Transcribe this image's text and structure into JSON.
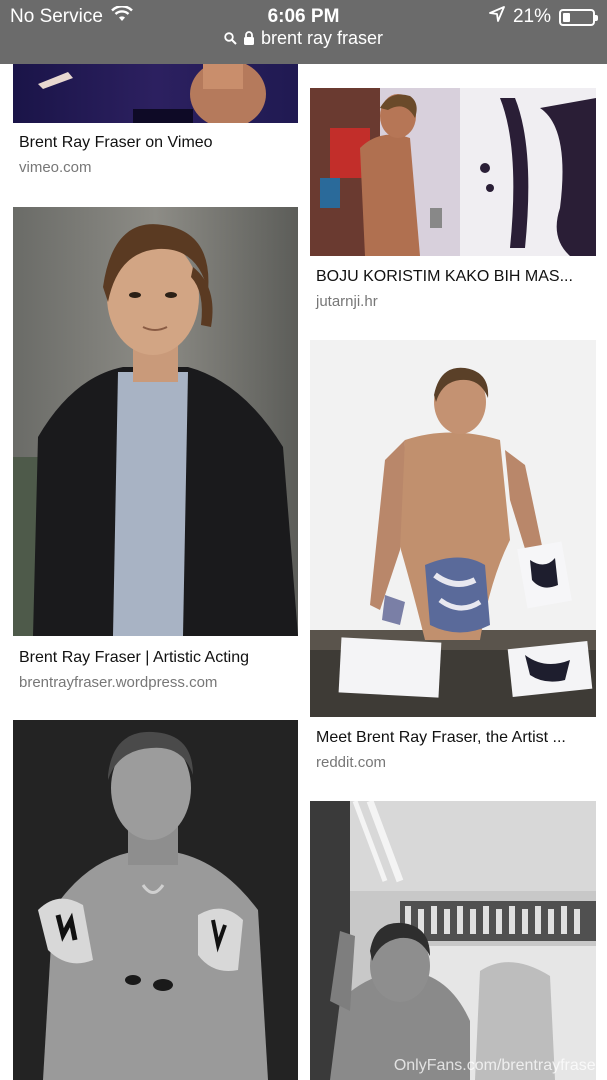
{
  "status_bar": {
    "carrier": "No Service",
    "time": "6:06 PM",
    "battery_percent": "21%",
    "battery_level": 0.21,
    "icons": [
      "wifi-icon",
      "location-arrow-icon",
      "battery-icon"
    ]
  },
  "url_bar": {
    "query": "brent ray fraser",
    "icons": [
      "search-icon",
      "lock-icon"
    ]
  },
  "results_left": [
    {
      "title": "Brent Ray Fraser on Vimeo",
      "source": "vimeo.com"
    },
    {
      "title": "Brent Ray Fraser | Artistic Acting",
      "source": "brentrayfraser.wordpress.com"
    },
    {
      "title": "",
      "source": ""
    }
  ],
  "results_right": [
    {
      "title": "BOJU KORISTIM KAKO BIH MAS...",
      "source": "jutarnji.hr"
    },
    {
      "title": "Meet Brent Ray Fraser, the Artist ...",
      "source": "reddit.com"
    },
    {
      "title": "",
      "source": ""
    }
  ],
  "watermark": "OnlyFans.com/brentrayfraser",
  "colors": {
    "topbar": "#6b6b6b",
    "title": "#111111",
    "source": "#777777"
  }
}
